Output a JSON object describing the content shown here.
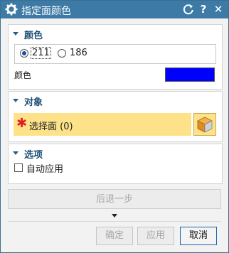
{
  "window": {
    "title": "指定面颜色"
  },
  "sections": {
    "color": {
      "title": "颜色",
      "radio_options": [
        "211",
        "186"
      ],
      "selected_index": 0,
      "color_label": "颜色",
      "swatch_color": "#0000ff"
    },
    "object": {
      "title": "对象",
      "select_label": "选择面 (0)"
    },
    "options": {
      "title": "选项",
      "auto_apply_label": "自动应用",
      "auto_apply_checked": false
    }
  },
  "undo_label": "后退一步",
  "buttons": {
    "ok": "确定",
    "apply": "应用",
    "cancel": "取消"
  },
  "colors": {
    "title_bar": "#3d7ba6",
    "highlight": "#fde28a",
    "required_marker": "#e02020"
  }
}
